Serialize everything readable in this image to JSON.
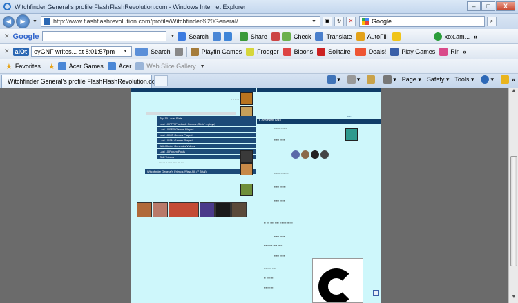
{
  "window": {
    "title": "Witchfinder General's profile FlashFlashRevolution.com - Windows Internet Explorer",
    "min_label": "–",
    "max_label": "□",
    "close_label": "X"
  },
  "address_bar": {
    "url": "http://www.flashflashrevolution.com/profile/Witchfinder%20General/",
    "search_placeholder": "Google"
  },
  "google_toolbar": {
    "logo": "Google",
    "items": [
      "Search",
      "Share",
      "Check",
      "Translate",
      "AutoFill",
      "xox.am..."
    ]
  },
  "aloot_toolbar": {
    "logo": "alOt",
    "dropdown_value": "oyGNF writes...   at 8:01:57pm",
    "search_label": "Search",
    "items": [
      "Playfin Games",
      "Frogger",
      "Bloons",
      "Solitaire",
      "Deals!",
      "Play Games",
      "Rir"
    ]
  },
  "favorites_bar": {
    "favorites_label": "Favorites",
    "items": [
      "Acer Games",
      "Acer",
      "Web Slice Gallery"
    ]
  },
  "tabs": {
    "active": "Witchfinder General's profile FlashFlashRevolution.com"
  },
  "commands": {
    "page": "Page",
    "safety": "Safety",
    "tools": "Tools"
  },
  "page": {
    "left_links": [
      "Top 10 Level Stats",
      "Last 10 FFR Playback Games (Slots' replays)",
      "Last 10 FFR Games Played",
      "Last 10 MP Games Played",
      "Last 10 SM Games Played",
      "Witchfinder General's Videos",
      "Last 10 Forum Posts",
      "Skill Tokens"
    ],
    "friends_header": "Witchfinder General's Friends (View All) (7 Total)",
    "comment_header": "Comment wall"
  },
  "colors": {
    "page_bg": "#cef7fb",
    "header_blue": "#103d68",
    "outer_bg": "#6b6b6b"
  }
}
